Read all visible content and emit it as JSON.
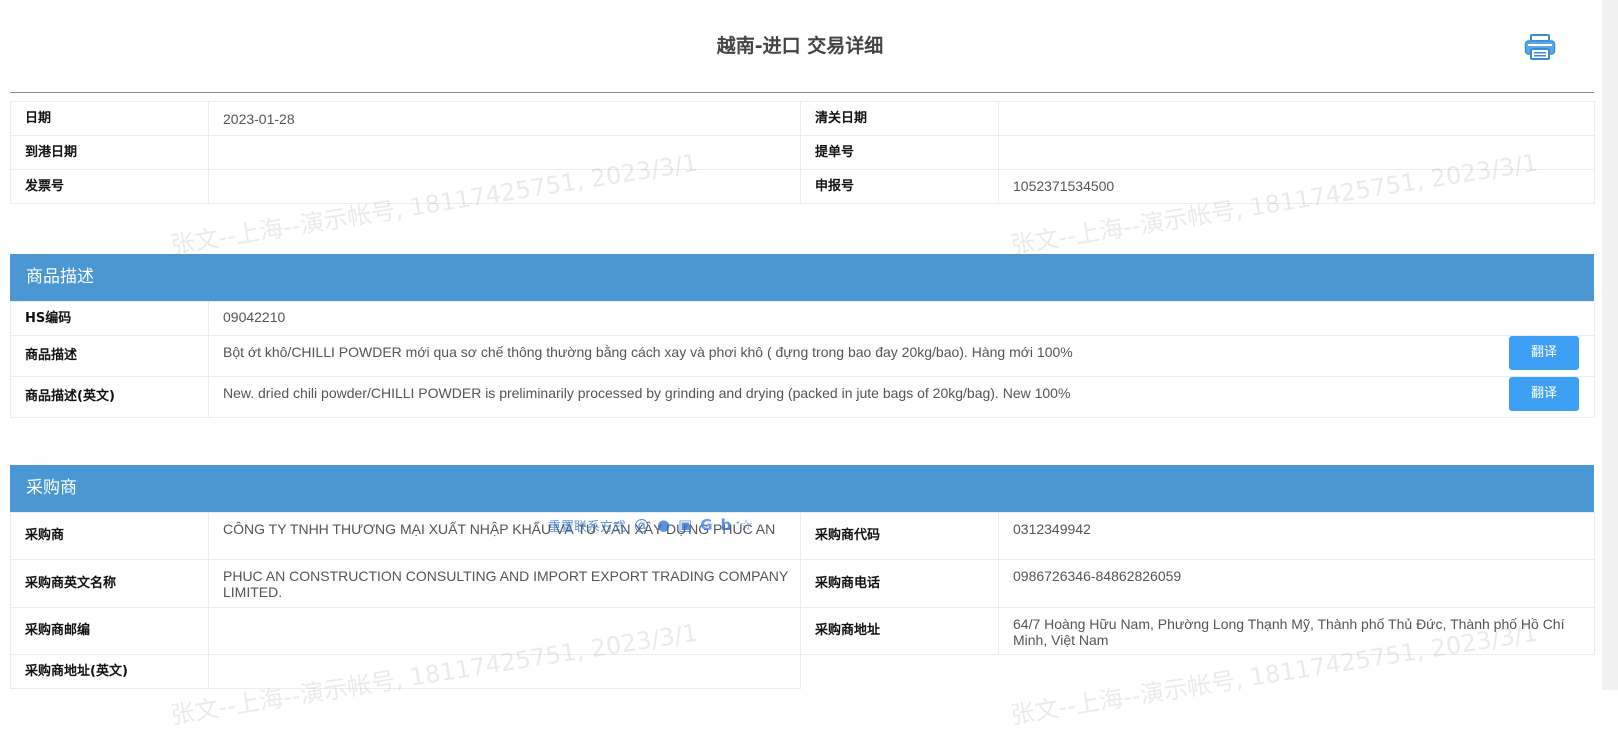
{
  "page": {
    "title": "越南-进口 交易详细"
  },
  "icons": {
    "print": "printer-icon"
  },
  "colors": {
    "section_header": "#4a97d3",
    "button": "#3ea0f5"
  },
  "basic_info": {
    "date_label": "日期",
    "date_value": "2023-01-28",
    "clearance_date_label": "清关日期",
    "clearance_date_value": "",
    "arrival_date_label": "到港日期",
    "arrival_date_value": "",
    "bill_no_label": "提单号",
    "bill_no_value": "",
    "invoice_no_label": "发票号",
    "invoice_no_value": "",
    "declaration_no_label": "申报号",
    "declaration_no_value": "1052371534500"
  },
  "goods": {
    "header": "商品描述",
    "hs_label": "HS编码",
    "hs_value": "09042210",
    "desc_label": "商品描述",
    "desc_value": "Bột ớt khô/CHILLI POWDER mới qua sơ chế thông thường bằng cách xay và phơi khô ( đựng trong bao đay 20kg/bao). Hàng mới 100%",
    "desc_en_label": "商品描述(英文)",
    "desc_en_value": "New. dried chili powder/CHILLI POWDER is preliminarily processed by grinding and drying (packed in jute bags of 20kg/bag). New 100%",
    "translate_label": "翻译"
  },
  "buyer": {
    "header": "采购商",
    "name_label": "采购商",
    "name_value": "CÔNG TY TNHH THƯƠNG MẠI XUẤT NHẬP KHẨU VÀ TƯ VẤN XÂY DỰNG PHÚC AN",
    "code_label": "采购商代码",
    "code_value": "0312349942",
    "en_name_label": "采购商英文名称",
    "en_name_value": "PHUC AN CONSTRUCTION CONSULTING AND IMPORT EXPORT TRADING COMPANY LIMITED.",
    "phone_label": "采购商电话",
    "phone_value": "0986726346-84862826059",
    "postcode_label": "采购商邮编",
    "postcode_value": "",
    "address_label": "采购商地址",
    "address_value": "64/7 Hoàng Hữu Nam, Phường Long Thạnh Mỹ, Thành phố Thủ Đức, Thành phố Hồ Chí Minh, Việt Nam",
    "address_en_label": "采购商地址(英文)",
    "address_en_value": ""
  },
  "overlay_toolbar": {
    "text": "重置联系方式",
    "icons": [
      "at-icon",
      "circle-icon",
      "copy-icon",
      "google-icon",
      "bing-icon",
      "star-icon"
    ]
  },
  "watermark": {
    "text": "张文--上海--演示帐号, 18117425751, 2023/3/1"
  }
}
